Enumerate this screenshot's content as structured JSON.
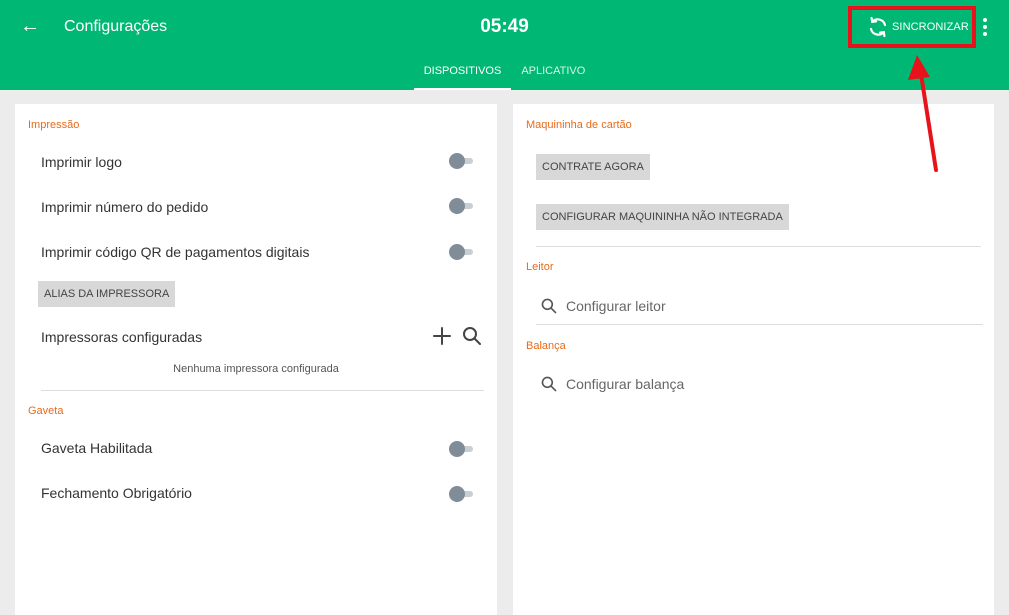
{
  "header": {
    "title": "Configurações",
    "clock": "05:49",
    "sync_label": "SINCRONIZAR",
    "tabs": [
      {
        "label": "DISPOSITIVOS",
        "active": true
      },
      {
        "label": "APLICATIVO",
        "active": false
      }
    ]
  },
  "colors": {
    "appbar": "#00b874",
    "section_heading": "#e96a1a",
    "highlight_box": "#e8121b",
    "toggle_off": "#808d99"
  },
  "icons": {
    "back": "arrow-left-icon",
    "sync": "sync-icon",
    "menu": "more-vertical-icon",
    "add": "plus-icon",
    "search": "search-icon"
  },
  "left_panel": {
    "printing": {
      "heading": "Impressão",
      "toggles": [
        {
          "label": "Imprimir logo",
          "on": false
        },
        {
          "label": "Imprimir número do pedido",
          "on": false
        },
        {
          "label": "Imprimir código QR de pagamentos digitais",
          "on": false
        }
      ],
      "alias_button": "ALIAS DA IMPRESSORA",
      "configured_label": "Impressoras configuradas",
      "empty_message": "Nenhuma impressora configurada"
    },
    "drawer": {
      "heading": "Gaveta",
      "toggles": [
        {
          "label": "Gaveta Habilitada",
          "on": false
        },
        {
          "label": "Fechamento Obrigatório",
          "on": false
        }
      ]
    }
  },
  "right_panel": {
    "card_machine": {
      "heading": "Maquininha de cartão",
      "buttons": [
        "CONTRATE AGORA",
        "CONFIGURAR MAQUININHA NÃO INTEGRADA"
      ]
    },
    "reader": {
      "heading": "Leitor",
      "action": "Configurar leitor"
    },
    "scale": {
      "heading": "Balança",
      "action": "Configurar balança"
    }
  }
}
